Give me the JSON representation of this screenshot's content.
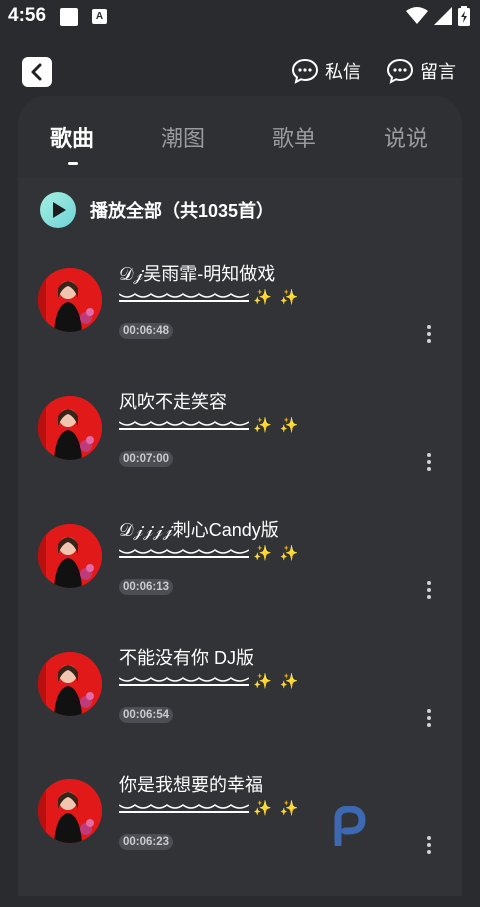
{
  "status_bar": {
    "time": "4:56",
    "notif_letter": "A"
  },
  "header": {
    "messages_label": "私信",
    "comments_label": "留言"
  },
  "tabs": [
    {
      "label": "歌曲",
      "active": true
    },
    {
      "label": "潮图",
      "active": false
    },
    {
      "label": "歌单",
      "active": false
    },
    {
      "label": "说说",
      "active": false
    }
  ],
  "play_all": {
    "label": "播放全部（共1035首）"
  },
  "songs": [
    {
      "title": "𝒟𝒿吴雨霏-明知做戏",
      "duration": "00:06:48"
    },
    {
      "title": "风吹不走笑容",
      "duration": "00:07:00"
    },
    {
      "title": "𝒟𝒿𝒿𝒿𝒿刺心Candy版",
      "duration": "00:06:13"
    },
    {
      "title": "不能没有你 DJ版",
      "duration": "00:06:54"
    },
    {
      "title": "你是我想要的幸福",
      "duration": "00:06:23"
    }
  ],
  "decoration": {
    "sparkles": "✨ ✨"
  },
  "colors": {
    "background": "#2a2b2e",
    "panel": "#323337",
    "cover_red": "#e11919",
    "play_gradient": "#6fd3d8",
    "sparkle": "#f5cd3a"
  },
  "icons": [
    "back-icon",
    "chat-bubble-icon",
    "play-icon",
    "more-vert-icon",
    "wifi-icon",
    "signal-icon",
    "battery-icon"
  ]
}
